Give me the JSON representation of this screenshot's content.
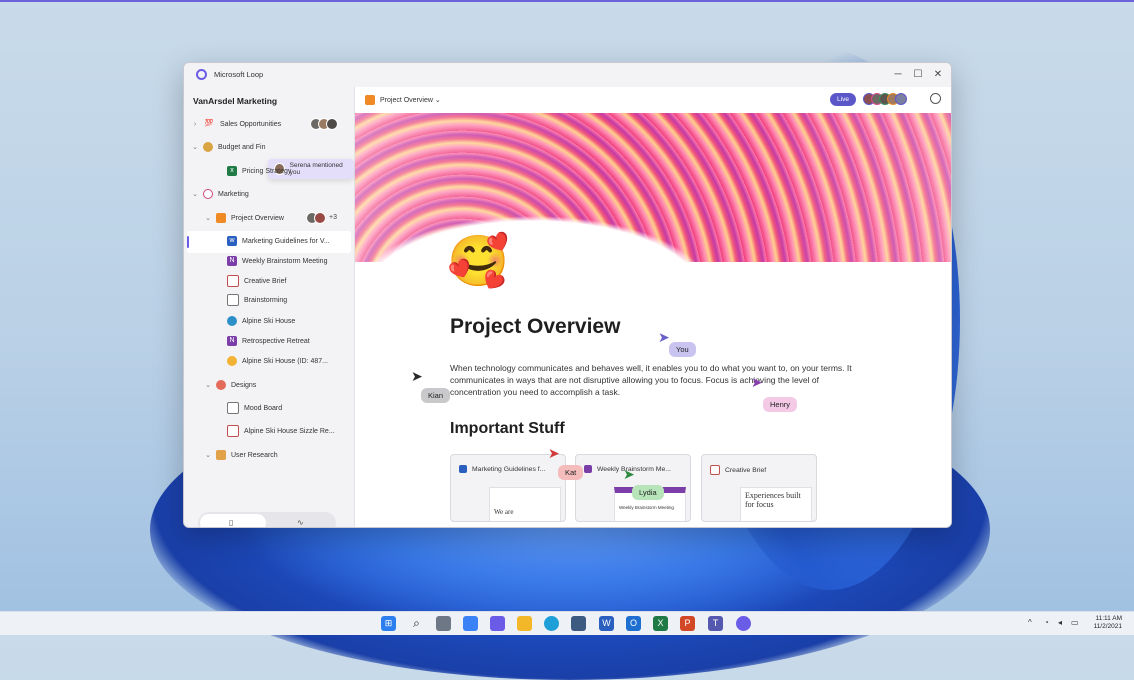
{
  "window": {
    "title": "Microsoft Loop",
    "controls": [
      "─",
      "☐",
      "✕"
    ]
  },
  "sidebar": {
    "workspace_title": "VanArsdel Marketing",
    "items": [
      {
        "label": "Sales Opportunities",
        "chevron": "›",
        "icon": "100-emoji-icon"
      },
      {
        "label": "Budget and Fin",
        "chevron": "⌄",
        "icon": "money-bag-icon"
      },
      {
        "label": "Pricing Strategy",
        "chevron": "",
        "icon": "excel-icon"
      },
      {
        "label": "Marketing",
        "chevron": "⌄",
        "icon": "loop-workspace-icon"
      },
      {
        "label": "Project Overview",
        "chevron": "⌄",
        "icon": "project-emoji-icon",
        "extra": "+3"
      },
      {
        "label": "Marketing Guidelines for V...",
        "chevron": "",
        "icon": "word-icon"
      },
      {
        "label": "Weekly Brainstorm Meeting",
        "chevron": "",
        "icon": "onenote-icon"
      },
      {
        "label": "Creative Brief",
        "chevron": "",
        "icon": "doc-icon"
      },
      {
        "label": "Brainstorming",
        "chevron": "",
        "icon": "whiteboard-icon"
      },
      {
        "label": "Alpine Ski House",
        "chevron": "",
        "icon": "globe-icon"
      },
      {
        "label": "Retrospective Retreat",
        "chevron": "",
        "icon": "onenote-icon"
      },
      {
        "label": "Alpine Ski House (ID: 487...",
        "chevron": "",
        "icon": "emoji-icon"
      },
      {
        "label": "Designs",
        "chevron": "⌄",
        "icon": "palette-icon"
      },
      {
        "label": "Mood Board",
        "chevron": "",
        "icon": "whiteboard-icon"
      },
      {
        "label": "Alpine Ski House Sizzle Re...",
        "chevron": "",
        "icon": "video-icon"
      },
      {
        "label": "User Research",
        "chevron": "⌄",
        "icon": "thumbs-up-icon"
      }
    ],
    "mention_toast": "Serena mentioned you"
  },
  "page": {
    "breadcrumb": "Project Overview",
    "breadcrumb_chevron": "⌄",
    "live_badge": "Live",
    "title": "Project Overview",
    "body": "When technology communicates and behaves well, it enables you to do what you want to, on your terms. It communicates in ways that are not disruptive allowing you to focus. Focus is achieving the level of concentration you need to accomplish a task.",
    "section_heading": "Important Stuff",
    "cards": [
      {
        "title": "Marketing Guidelines f...",
        "thumb_text": "We are"
      },
      {
        "title": "Weekly Brainstorm Me...",
        "thumb_text": "Weekly Brainstorm Meeting"
      },
      {
        "title": "Creative Brief",
        "thumb_text": "Experiences built for focus"
      }
    ]
  },
  "cursors": [
    {
      "name": "You",
      "color": "#c9c3f0"
    },
    {
      "name": "Kian",
      "color": "#c9c9cc"
    },
    {
      "name": "Henry",
      "color": "#f3c9e6"
    },
    {
      "name": "Kat",
      "color": "#f5bcbc"
    },
    {
      "name": "Lydia",
      "color": "#b7e4b8"
    }
  ],
  "taskbar": {
    "clock_time": "11:11 AM",
    "clock_date": "11/2/2021",
    "tray_chevron": "^"
  },
  "colors": {
    "accent": "#6b5ce7",
    "live": "#5b57c9",
    "wallpaper_blue": "#1e4fc4"
  }
}
